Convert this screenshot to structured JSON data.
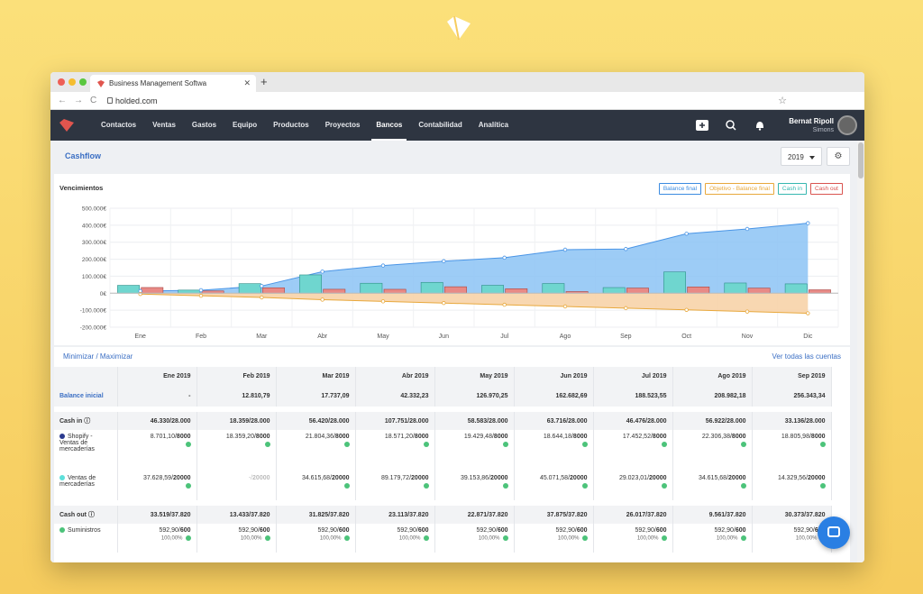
{
  "browser": {
    "tab_title": "Business Management Softwa",
    "url": "holded.com"
  },
  "nav": {
    "items": [
      {
        "label": "Contactos"
      },
      {
        "label": "Ventas"
      },
      {
        "label": "Gastos"
      },
      {
        "label": "Equipo"
      },
      {
        "label": "Productos"
      },
      {
        "label": "Proyectos"
      },
      {
        "label": "Bancos",
        "active": true
      },
      {
        "label": "Contabilidad"
      },
      {
        "label": "Analítica"
      }
    ],
    "user_name": "Bernat Ripoll",
    "user_company": "Simons"
  },
  "page": {
    "title": "Cashflow",
    "year": "2019"
  },
  "chart_title": "Vencimientos",
  "chart_data": {
    "type": "bar",
    "title": "Vencimientos",
    "categories": [
      "Ene",
      "Feb",
      "Mar",
      "Abr",
      "May",
      "Jun",
      "Jul",
      "Ago",
      "Sep",
      "Oct",
      "Nov",
      "Dic"
    ],
    "ylim": [
      -200000,
      500000
    ],
    "yticks": [
      "500.000€",
      "400.000€",
      "300.000€",
      "200.000€",
      "100.000€",
      "0€",
      "-100.000€",
      "-200.000€"
    ],
    "legend": [
      "Balance final",
      "Objetivo - Balance final",
      "Cash in",
      "Cash out"
    ],
    "legend_position": "top-right",
    "series": [
      {
        "name": "Balance final",
        "type": "area",
        "color": "#5aa6ef",
        "values": [
          12800,
          17700,
          42300,
          127000,
          162700,
          188500,
          209000,
          256000,
          260000,
          350000,
          378000,
          412000
        ]
      },
      {
        "name": "Objetivo - Balance final",
        "type": "area",
        "color": "#f5c07a",
        "values": [
          -5000,
          -15000,
          -25000,
          -38000,
          -48000,
          -58000,
          -68000,
          -78000,
          -88000,
          -98000,
          -108000,
          -118000
        ]
      },
      {
        "name": "Cash in",
        "type": "bar",
        "color": "#5ccdc8",
        "values": [
          46330,
          18359,
          56420,
          107751,
          58583,
          63716,
          46476,
          56922,
          33136,
          125000,
          60000,
          55000
        ]
      },
      {
        "name": "Cash out",
        "type": "bar",
        "color": "#e06a6a",
        "values": [
          33519,
          13433,
          31825,
          23113,
          22871,
          37875,
          26017,
          9561,
          30373,
          37000,
          30000,
          20000
        ]
      }
    ]
  },
  "table": {
    "minimize_label": "Minimizar / Maximizar",
    "see_all_label": "Ver todas las cuentas",
    "months": [
      "Ene 2019",
      "Feb 2019",
      "Mar 2019",
      "Abr 2019",
      "May 2019",
      "Jun 2019",
      "Jul 2019",
      "Ago 2019",
      "Sep 2019"
    ],
    "balance_label": "Balance inicial",
    "balance": [
      "-",
      "12.810,79",
      "17.737,09",
      "42.332,23",
      "126.970,25",
      "162.682,69",
      "188.523,55",
      "208.982,18",
      "256.343,34"
    ],
    "cash_in_label": "Cash in ⓘ",
    "cash_in": [
      "46.330/28.000",
      "18.359/28.000",
      "56.420/28.000",
      "107.751/28.000",
      "58.583/28.000",
      "63.716/28.000",
      "46.476/28.000",
      "56.922/28.000",
      "33.136/28.000"
    ],
    "shopify_label": "Shopify - Ventas de mercaderías",
    "shopify": [
      [
        "8.701,10/",
        "8000"
      ],
      [
        "18.359,20/",
        "8000"
      ],
      [
        "21.804,36/",
        "8000"
      ],
      [
        "18.571,20/",
        "8000"
      ],
      [
        "19.429,48/",
        "8000"
      ],
      [
        "18.644,18/",
        "8000"
      ],
      [
        "17.452,52/",
        "8000"
      ],
      [
        "22.306,38/",
        "8000"
      ],
      [
        "18.805,98/",
        "8000"
      ]
    ],
    "ventas_label": "Ventas de mercaderías",
    "ventas": [
      [
        "37.628,59/",
        "20000"
      ],
      [
        "-/",
        "20000"
      ],
      [
        "34.615,68/",
        "20000"
      ],
      [
        "89.179,72/",
        "20000"
      ],
      [
        "39.153,86/",
        "20000"
      ],
      [
        "45.071,58/",
        "20000"
      ],
      [
        "29.023,01/",
        "20000"
      ],
      [
        "34.615,68/",
        "20000"
      ],
      [
        "14.329,56/",
        "20000"
      ]
    ],
    "cash_out_label": "Cash out ⓘ",
    "cash_out": [
      "33.519/37.820",
      "13.433/37.820",
      "31.825/37.820",
      "23.113/37.820",
      "22.871/37.820",
      "37.875/37.820",
      "26.017/37.820",
      "9.561/37.820",
      "30.373/37.820"
    ],
    "suministros_label": "Suministros",
    "suministros": [
      [
        "592,90/",
        "600"
      ],
      [
        "592,90/",
        "600"
      ],
      [
        "592,90/",
        "600"
      ],
      [
        "592,90/",
        "600"
      ],
      [
        "592,90/",
        "600"
      ],
      [
        "592,90/",
        "600"
      ],
      [
        "592,90/",
        "600"
      ],
      [
        "592,90/",
        "600"
      ],
      [
        "592,90/",
        "600"
      ]
    ],
    "suministros_pct": "100,00%"
  }
}
